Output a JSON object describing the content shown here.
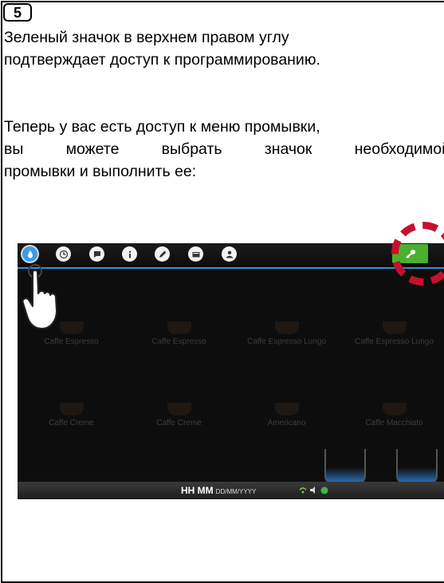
{
  "step": {
    "number": "5"
  },
  "paragraph1": {
    "line1": "Зеленый значок в верхнем правом углу",
    "line2": "подтверждает доступ к программированию."
  },
  "paragraph2": {
    "line1": "Теперь у вас есть доступ к меню промывки,",
    "line2": "вы можете выбрать значок необходимой",
    "line3": "промывки и выполнить ее:"
  },
  "screen": {
    "tiles": [
      "Caffe Espresso",
      "Caffe Espresso",
      "Caffe Espresso Lungo",
      "Caffe Espresso Lungo",
      "Caffe Creme",
      "Caffe Creme",
      "Americano",
      "Caffe Macchiato"
    ],
    "status": {
      "time": "HH MM",
      "date": "DD/MM/YYYY"
    },
    "colors": {
      "key_button": "#4caf2f",
      "highlight": "#c8102e",
      "active_icon": "#3c9be8"
    },
    "toolbar_icons": [
      "water-drop-icon",
      "clock-icon",
      "flag-icon",
      "info-icon",
      "pencil-icon",
      "card-icon",
      "person-icon"
    ],
    "key_icon": "key-icon"
  }
}
